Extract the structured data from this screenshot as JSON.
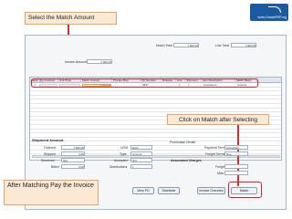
{
  "callouts": {
    "select_amount": "Select the Match Amount",
    "click_match": "Click on Match after Selecting",
    "after_matching": "After Matching Pay the Invoice"
  },
  "logo": {
    "text": "www.OracleERP.org"
  },
  "top": {
    "invoice_amount_label": "Invoice Amount",
    "invoice_amount_value": "7,000.00",
    "match_total_label": "Match Total",
    "match_total_value": "7,000.00",
    "line_total_label": "Line Total",
    "line_total_value": "7,000.00"
  },
  "grid": {
    "columns": [
      "Match",
      "Qty Invoiced",
      "Unit Price",
      "Match Amount",
      "Prorate Misc",
      "PO Number",
      "Release",
      "Line",
      "Shipment",
      "Item Description",
      "Match Basis"
    ],
    "row": {
      "match": "✔",
      "match_amount": "7,000.00",
      "po_number": "5847",
      "line": "1",
      "shipment": "1",
      "item_description": "Assistance",
      "match_basis": "Amount"
    }
  },
  "shipment_amount_label": "Shipment Amount",
  "purchase_order_label": "Purchase Order",
  "shipment": {
    "ordered_label": "Ordered",
    "ordered_value": "7,000.00",
    "shipped_label": "Shipped",
    "shipped_value": "0.00",
    "received_label": "Received",
    "received_value": "N/A",
    "billed_label": "Billed",
    "billed_value": "0.00",
    "uom_label": "UOM",
    "uom_value": "Each",
    "type_label": "Type",
    "type_value": "Amount",
    "accepted_label": "Accepted",
    "accepted_value": "N/A",
    "distributions_label": "Distributions",
    "distributions_value": "1"
  },
  "po": {
    "payment_terms_label": "Payment Terms",
    "payment_terms_value": "Immediate",
    "freight_terms_label": "Freight Terms",
    "freight_terms_value": "Due",
    "associated_charges_label": "Associated Charges",
    "freight_label": "Freight",
    "misc_label": "Misc"
  },
  "buttons": {
    "view_po": "View PO",
    "distribute": "Distribute",
    "invoice_overview": "Invoice Overview",
    "match": "Match"
  }
}
